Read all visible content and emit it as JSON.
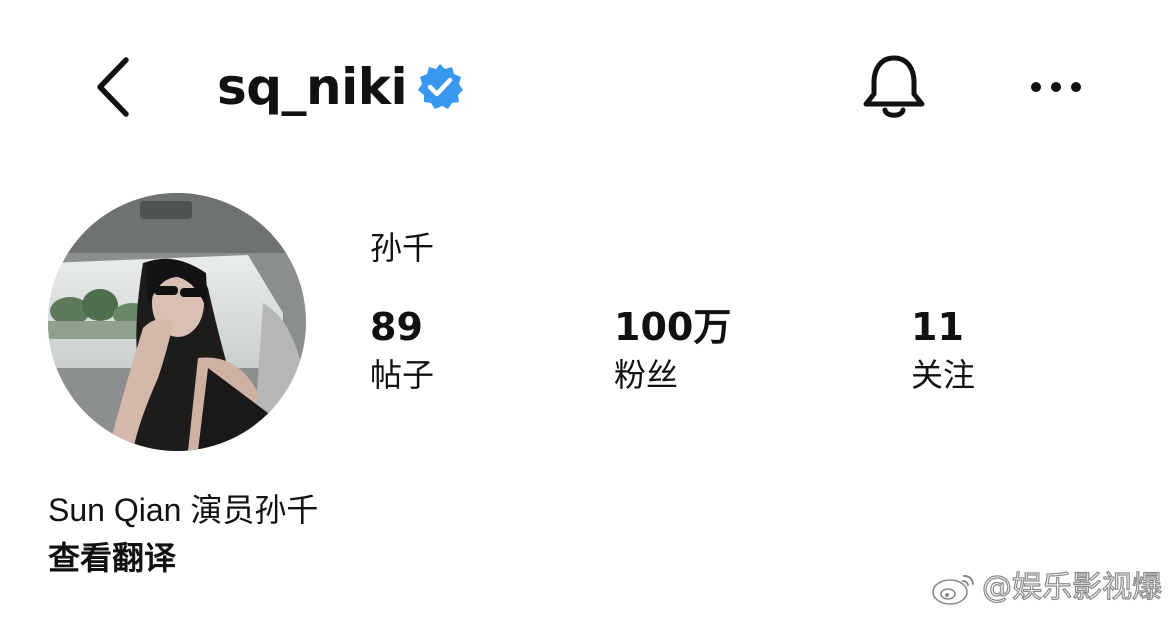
{
  "header": {
    "username": "sq_niki",
    "back_icon": "chevron-left-icon",
    "verified_icon": "verified-badge-icon",
    "bell_icon": "bell-icon",
    "more_icon": "more-horizontal-icon",
    "verified_color": "#3897f0"
  },
  "profile": {
    "display_name": "孙千",
    "avatar_icon": "avatar-photo"
  },
  "stats": {
    "posts": {
      "value": "89",
      "label": "帖子"
    },
    "followers": {
      "value": "100万",
      "label": "粉丝"
    },
    "following": {
      "value": "11",
      "label": "关注"
    }
  },
  "bio": {
    "text": "Sun Qian 演员孙千",
    "translate_label": "查看翻译"
  },
  "watermark": {
    "text": "@娱乐影视爆",
    "logo_icon": "weibo-logo-icon"
  }
}
